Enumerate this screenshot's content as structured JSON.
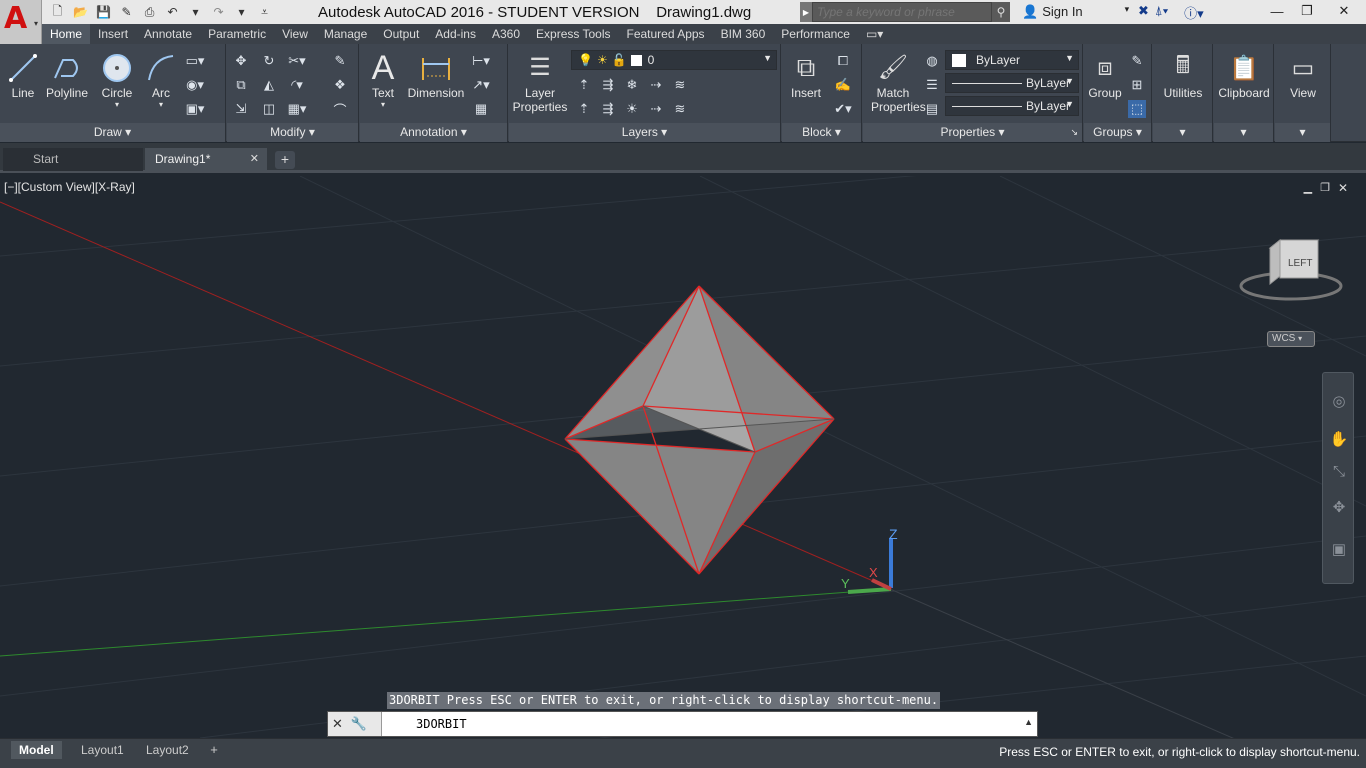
{
  "app": {
    "title": "Autodesk AutoCAD 2016 - STUDENT VERSION    Drawing1.dwg",
    "logo_letter": "A",
    "search_placeholder": "Type a keyword or phrase",
    "sign_in": "Sign In"
  },
  "ribbon_tabs": [
    "Home",
    "Insert",
    "Annotate",
    "Parametric",
    "View",
    "Manage",
    "Output",
    "Add-ins",
    "A360",
    "Express Tools",
    "Featured Apps",
    "BIM 360",
    "Performance"
  ],
  "ribbon": {
    "draw": {
      "title": "Draw",
      "line": "Line",
      "polyline": "Polyline",
      "circle": "Circle",
      "arc": "Arc"
    },
    "modify": {
      "title": "Modify"
    },
    "annotation": {
      "title": "Annotation",
      "text": "Text",
      "dimension": "Dimension"
    },
    "layers": {
      "title": "Layers",
      "layer_properties_1": "Layer",
      "layer_properties_2": "Properties",
      "current_layer": "0"
    },
    "block": {
      "title": "Block",
      "insert": "Insert"
    },
    "properties": {
      "title": "Properties",
      "match_1": "Match",
      "match_2": "Properties",
      "color": "ByLayer",
      "linetype": "ByLayer",
      "lineweight": "ByLayer"
    },
    "groups": {
      "title": "Groups",
      "group": "Group"
    },
    "utilities": "Utilities",
    "clipboard": "Clipboard",
    "view": "View"
  },
  "file_tabs": {
    "start": "Start",
    "drawing": "Drawing1*"
  },
  "viewport": {
    "label": "[−][Custom View][X-Ray]",
    "viewcube_face": "LEFT",
    "wcs": "WCS",
    "axis_z": "Z",
    "axis_y": "Y",
    "axis_x": "X"
  },
  "command": {
    "prompt": "3DORBIT Press ESC or ENTER to exit, or right-click to display shortcut-menu.",
    "input_value": "3DORBIT"
  },
  "status": {
    "layout_tabs": [
      "Model",
      "Layout1",
      "Layout2"
    ],
    "message": "Press ESC or ENTER to exit, or right-click to display shortcut-menu."
  },
  "colors": {
    "viewport_bg": "#212830",
    "accent_red": "#d01010",
    "edge_red": "#e02828"
  }
}
